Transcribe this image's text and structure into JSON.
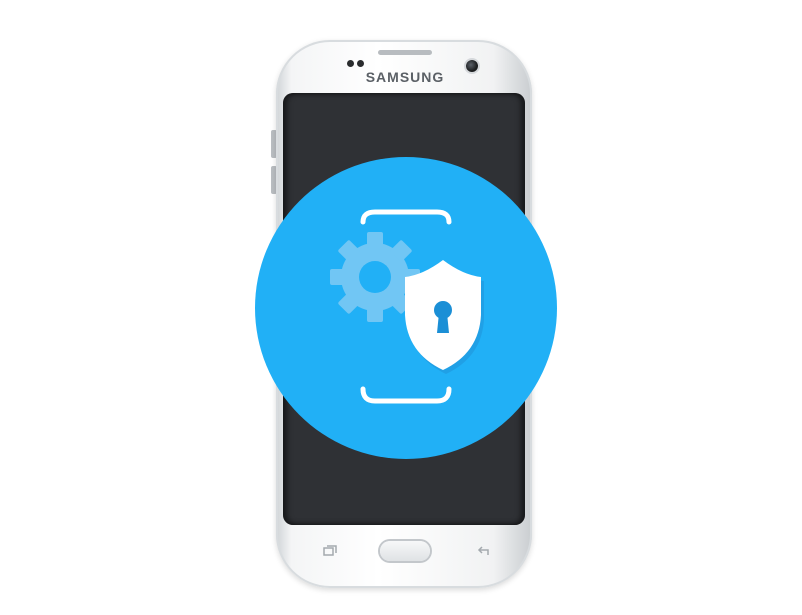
{
  "device": {
    "brand_text": "SAMSUNG",
    "body_color": "#f1f2f3",
    "screen_color": "#2f3135"
  },
  "badge": {
    "color": "#21b0f6",
    "icons": [
      "phone-frame-icon",
      "gear-icon",
      "shield-lock-icon"
    ]
  },
  "nav_keys": {
    "recent_icon": "recent-apps-icon",
    "home_icon": "home-button",
    "back_icon": "back-icon"
  }
}
